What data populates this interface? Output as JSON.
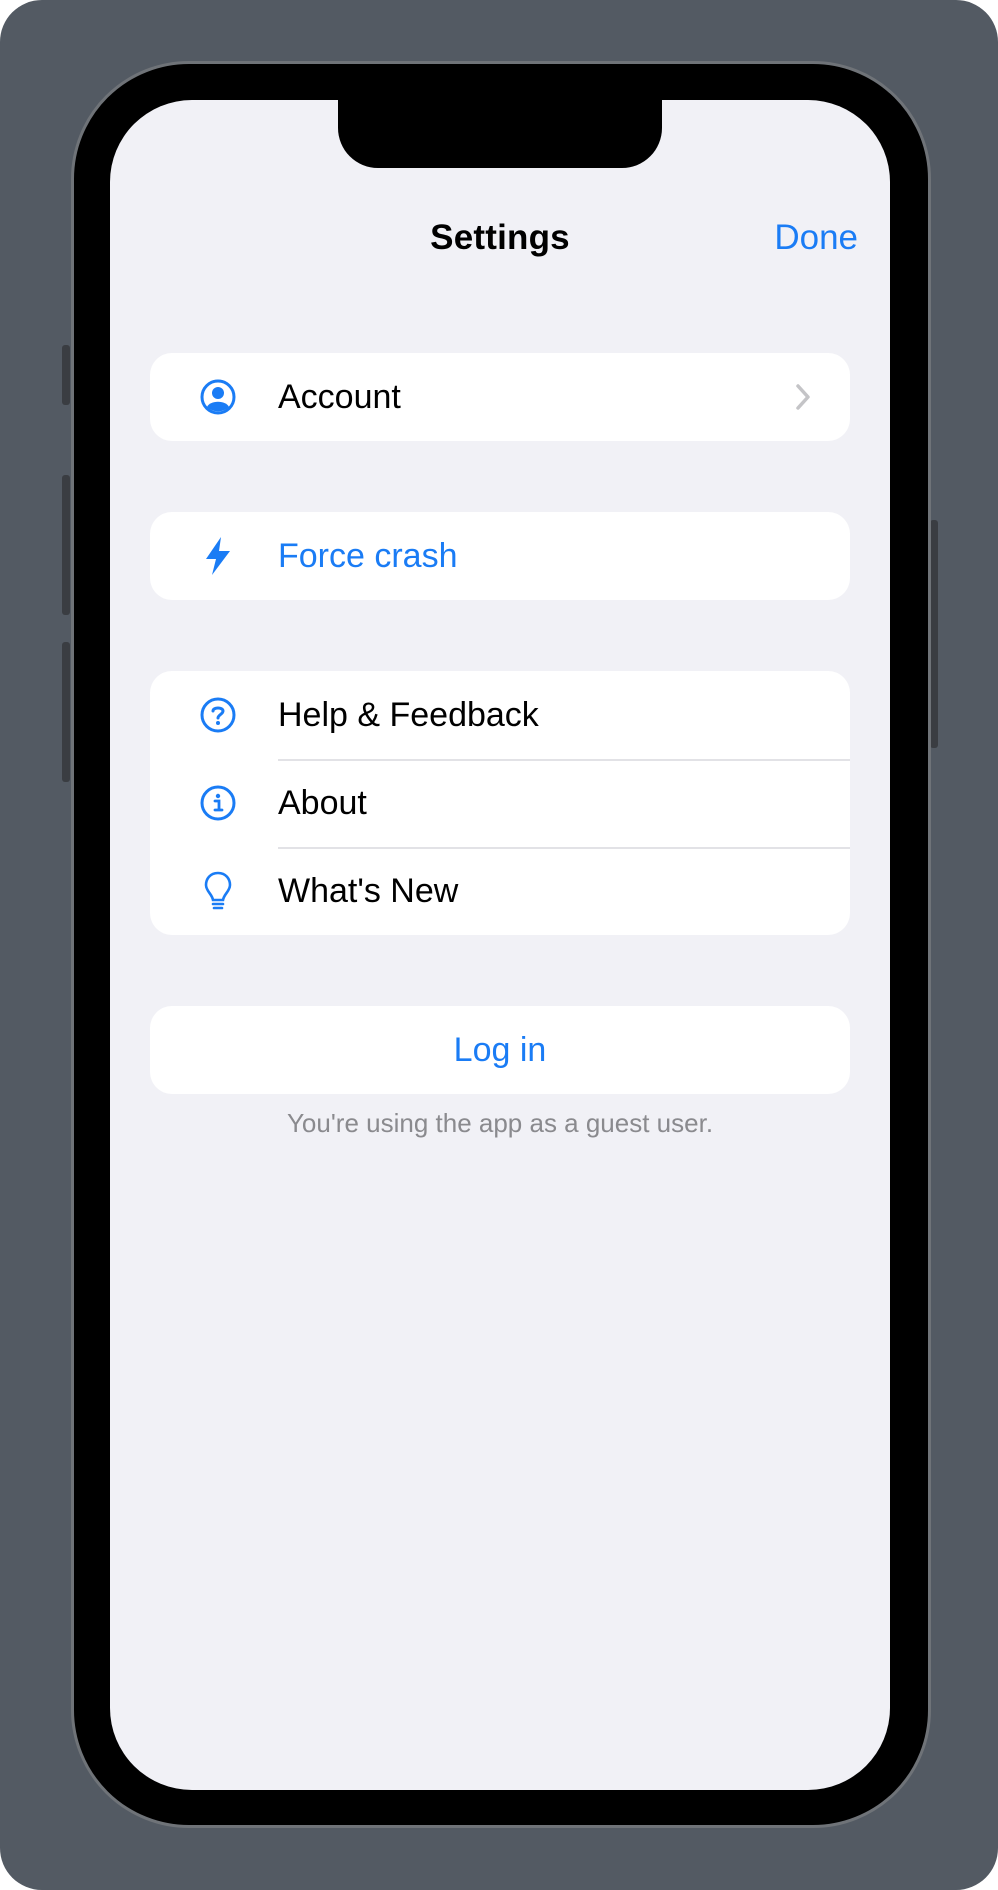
{
  "nav": {
    "title": "Settings",
    "done_label": "Done"
  },
  "groups": {
    "account": {
      "label": "Account",
      "icon": "person-circle-icon"
    },
    "crash": {
      "label": "Force crash",
      "icon": "bolt-icon"
    },
    "info": {
      "help_label": "Help & Feedback",
      "about_label": "About",
      "whats_new_label": "What's New"
    }
  },
  "login": {
    "label": "Log in",
    "footnote": "You're using the app as a guest user."
  },
  "colors": {
    "accent": "#1a7cf5",
    "background": "#f1f1f6",
    "frame": "#535a63"
  }
}
